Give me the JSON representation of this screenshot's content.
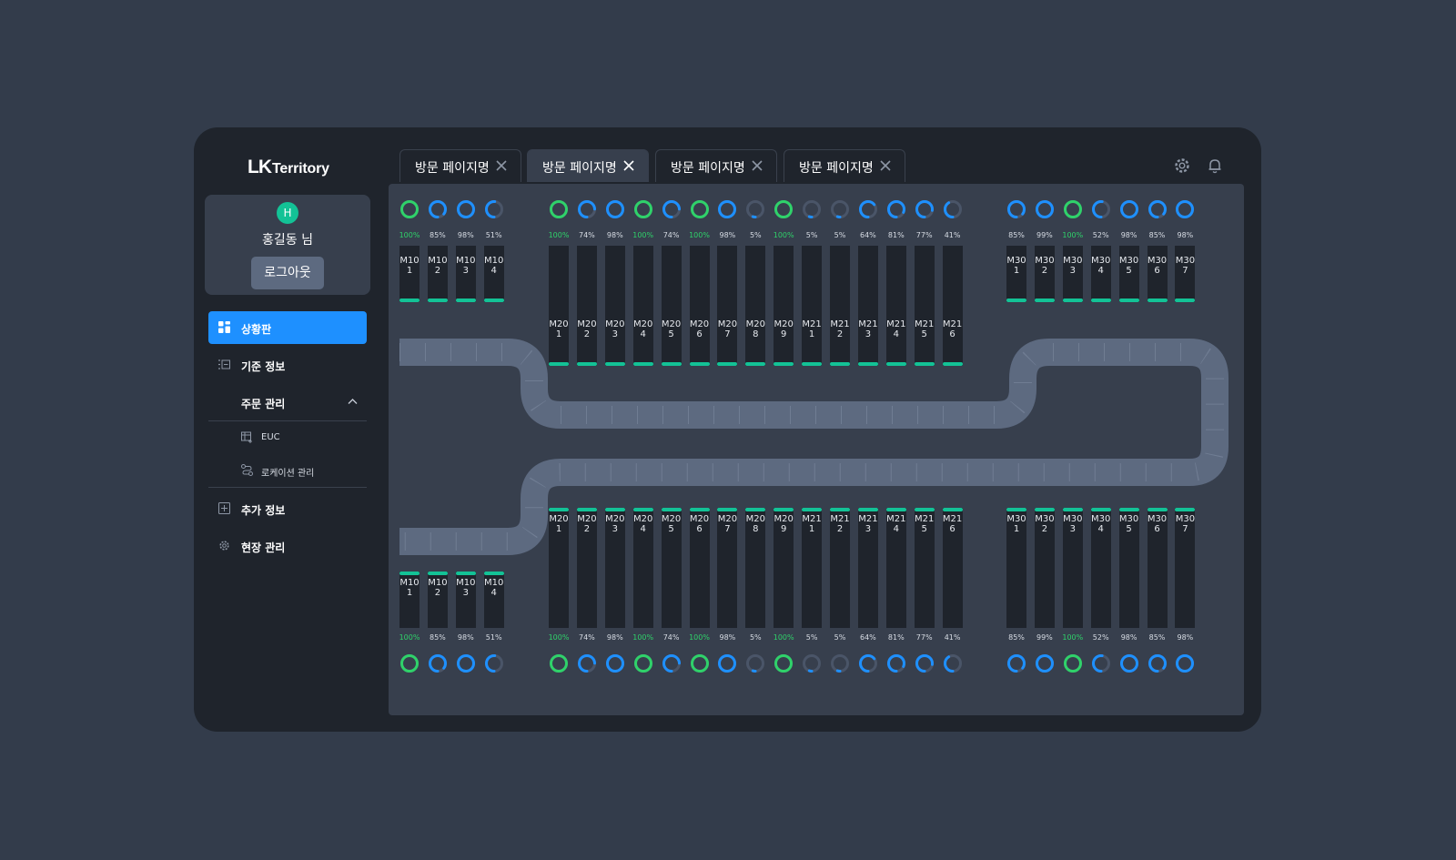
{
  "app": {
    "logo_mark": "LK",
    "logo_text": "Territory"
  },
  "user": {
    "avatar_initial": "H",
    "name": "홍길동 님",
    "logout_label": "로그아웃"
  },
  "menu": {
    "dashboard": "상황판",
    "base_info": "기준 정보",
    "order_mgmt": "주문 관리",
    "sub_euc": "EUC",
    "sub_location": "로케이션 관리",
    "extra_info": "추가 정보",
    "site_mgmt": "현장 관리"
  },
  "tabs": [
    {
      "label": "방문 페이지명",
      "active": false
    },
    {
      "label": "방문 페이지명",
      "active": true
    },
    {
      "label": "방문 페이지명",
      "active": false
    },
    {
      "label": "방문 페이지명",
      "active": false
    }
  ],
  "icons": {
    "settings": "gear-icon",
    "notifications": "bell-icon",
    "close": "close-icon",
    "collapse": "chevron-up-icon"
  },
  "colors": {
    "accent": "#1e90ff",
    "full": "#2fd26a",
    "ring_blue": "#1e90ff",
    "ring_track": "#4a5568",
    "machine_bar": "#13c296",
    "conveyor": "#5d6a80"
  },
  "groups": [
    {
      "machines": [
        {
          "id": "M101",
          "pct": 100
        },
        {
          "id": "M102",
          "pct": 85
        },
        {
          "id": "M103",
          "pct": 98
        },
        {
          "id": "M104",
          "pct": 51
        }
      ]
    },
    {
      "machines": [
        {
          "id": "M201",
          "pct": 100
        },
        {
          "id": "M202",
          "pct": 74
        },
        {
          "id": "M203",
          "pct": 98
        },
        {
          "id": "M204",
          "pct": 100
        },
        {
          "id": "M205",
          "pct": 74
        },
        {
          "id": "M206",
          "pct": 100
        },
        {
          "id": "M207",
          "pct": 98
        },
        {
          "id": "M208",
          "pct": 5
        },
        {
          "id": "M209",
          "pct": 100
        },
        {
          "id": "M211",
          "pct": 5
        },
        {
          "id": "M212",
          "pct": 5
        },
        {
          "id": "M213",
          "pct": 64
        },
        {
          "id": "M214",
          "pct": 81
        },
        {
          "id": "M215",
          "pct": 77
        },
        {
          "id": "M216",
          "pct": 41
        }
      ]
    },
    {
      "machines": [
        {
          "id": "M301",
          "pct": 85
        },
        {
          "id": "M302",
          "pct": 99
        },
        {
          "id": "M303",
          "pct": 100
        },
        {
          "id": "M304",
          "pct": 52
        },
        {
          "id": "M305",
          "pct": 98
        },
        {
          "id": "M306",
          "pct": 85
        },
        {
          "id": "M307",
          "pct": 98
        }
      ]
    }
  ]
}
